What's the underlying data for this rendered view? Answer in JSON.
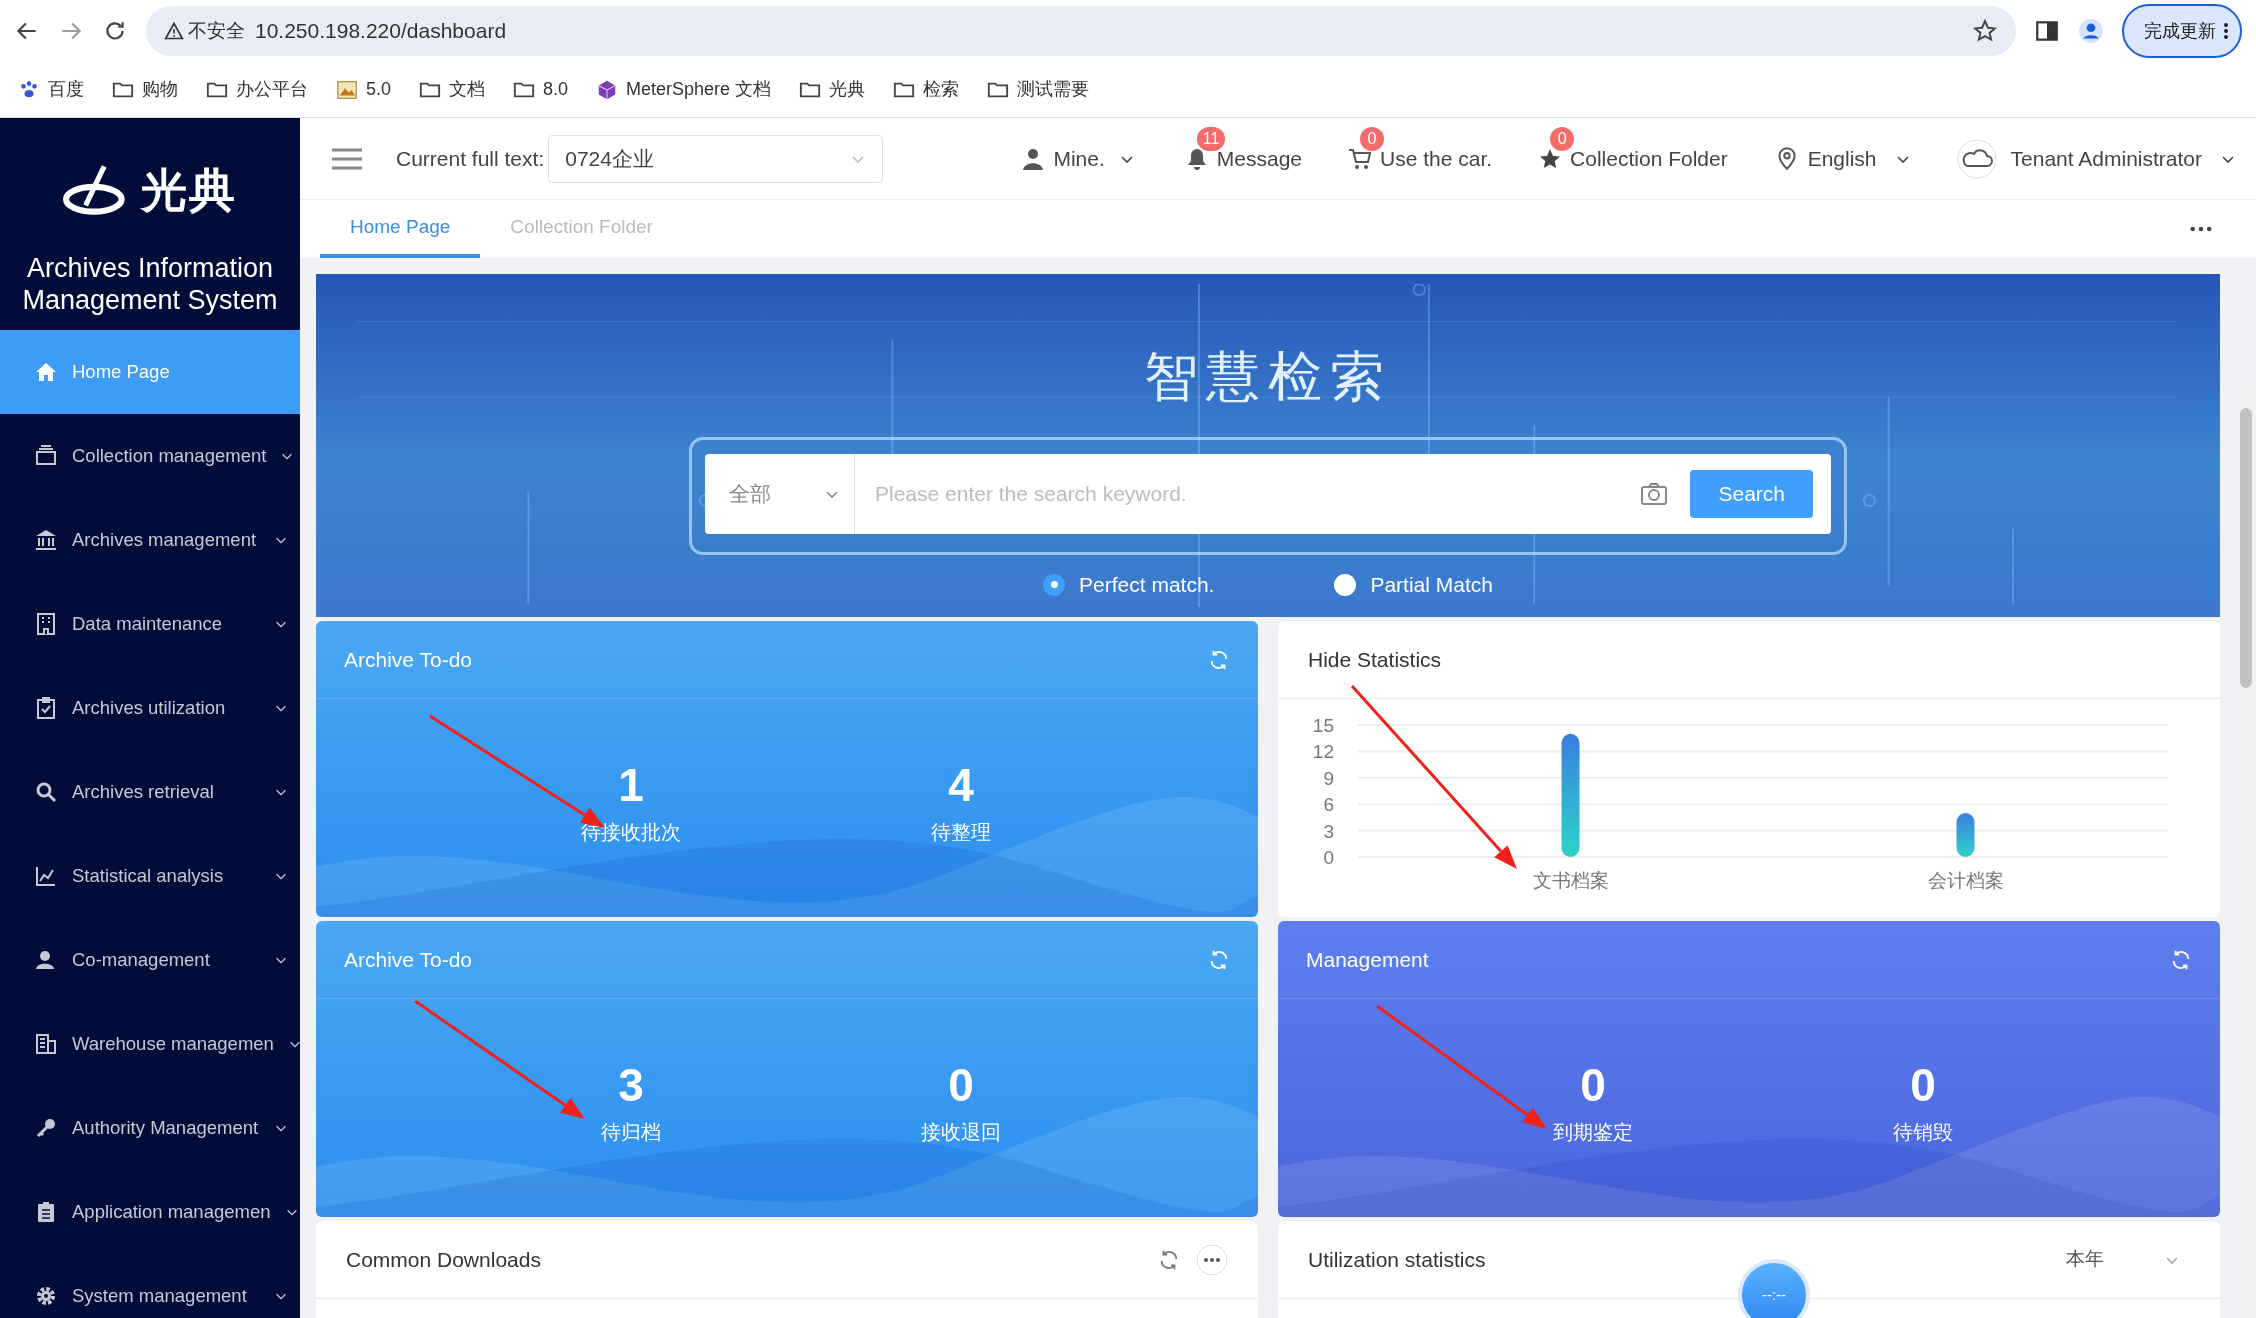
{
  "browser": {
    "security_label": "不安全",
    "url": "10.250.198.220/dashboard",
    "update_button": "完成更新",
    "bookmarks": [
      {
        "label": "百度",
        "kind": "paw"
      },
      {
        "label": "购物",
        "kind": "folder"
      },
      {
        "label": "办公平台",
        "kind": "folder"
      },
      {
        "label": "5.0",
        "kind": "image"
      },
      {
        "label": "文档",
        "kind": "folder"
      },
      {
        "label": "8.0",
        "kind": "folder"
      },
      {
        "label": "MeterSphere 文档",
        "kind": "cube"
      },
      {
        "label": "光典",
        "kind": "folder"
      },
      {
        "label": "检索",
        "kind": "folder"
      },
      {
        "label": "测试需要",
        "kind": "folder"
      }
    ]
  },
  "sidebar": {
    "logo_text": "光典",
    "system_title": "Archives Information Management System",
    "items": [
      {
        "label": "Home Page",
        "selected": true,
        "expandable": false
      },
      {
        "label": "Collection management",
        "selected": false,
        "expandable": true
      },
      {
        "label": "Archives management",
        "selected": false,
        "expandable": true
      },
      {
        "label": "Data maintenance",
        "selected": false,
        "expandable": true
      },
      {
        "label": "Archives utilization",
        "selected": false,
        "expandable": true
      },
      {
        "label": "Archives retrieval",
        "selected": false,
        "expandable": true
      },
      {
        "label": "Statistical analysis",
        "selected": false,
        "expandable": true
      },
      {
        "label": "Co-management",
        "selected": false,
        "expandable": true
      },
      {
        "label": "Warehouse managemen",
        "selected": false,
        "expandable": true
      },
      {
        "label": "Authority Management",
        "selected": false,
        "expandable": true
      },
      {
        "label": "Application managemen",
        "selected": false,
        "expandable": true
      },
      {
        "label": "System management",
        "selected": false,
        "expandable": true
      }
    ]
  },
  "header": {
    "fulltext_label": "Current full text:",
    "fulltext_value": "0724企业",
    "user": "Mine.",
    "actions": [
      {
        "kind": "bell",
        "badge": "11",
        "label": "Message"
      },
      {
        "kind": "cart",
        "badge": "0",
        "label": "Use the car."
      },
      {
        "kind": "star",
        "badge": "0",
        "label": "Collection Folder"
      }
    ],
    "language": "English",
    "tenant": "Tenant Administrator"
  },
  "tabs": [
    {
      "label": "Home Page",
      "selected": true
    },
    {
      "label": "Collection Folder",
      "selected": false
    }
  ],
  "banner": {
    "title": "智慧检索",
    "scope": "全部",
    "placeholder": "Please enter the search keyword.",
    "search_button": "Search",
    "match_options": [
      {
        "label": "Perfect match.",
        "selected": true
      },
      {
        "label": "Partial Match",
        "selected": false
      }
    ]
  },
  "todo_cards": [
    {
      "kind": "todo",
      "title": "Archive To-do",
      "items": [
        {
          "value": "1",
          "label": "待接收批次"
        },
        {
          "value": "4",
          "label": "待整理"
        }
      ]
    },
    {
      "kind": "chart",
      "title": "Hide Statistics",
      "chart_data": {
        "type": "bar",
        "categories": [
          "文书档案",
          "会计档案"
        ],
        "values": [
          14,
          5
        ],
        "ylim": [
          0,
          15
        ],
        "yticks": [
          0,
          3,
          6,
          9,
          12,
          15
        ],
        "grid": true
      }
    },
    {
      "kind": "todo",
      "title": "Archive To-do",
      "items": [
        {
          "value": "3",
          "label": "待归档"
        },
        {
          "value": "0",
          "label": "接收退回"
        }
      ]
    },
    {
      "kind": "management",
      "title": "Management",
      "items": [
        {
          "value": "0",
          "label": "到期鉴定"
        },
        {
          "value": "0",
          "label": "待销毁"
        }
      ]
    }
  ],
  "bottom_cards": [
    {
      "title": "Common Downloads",
      "kind": "downloads"
    },
    {
      "title": "Utilization statistics",
      "kind": "utilization",
      "period": "本年",
      "dial": "--:--"
    }
  ]
}
